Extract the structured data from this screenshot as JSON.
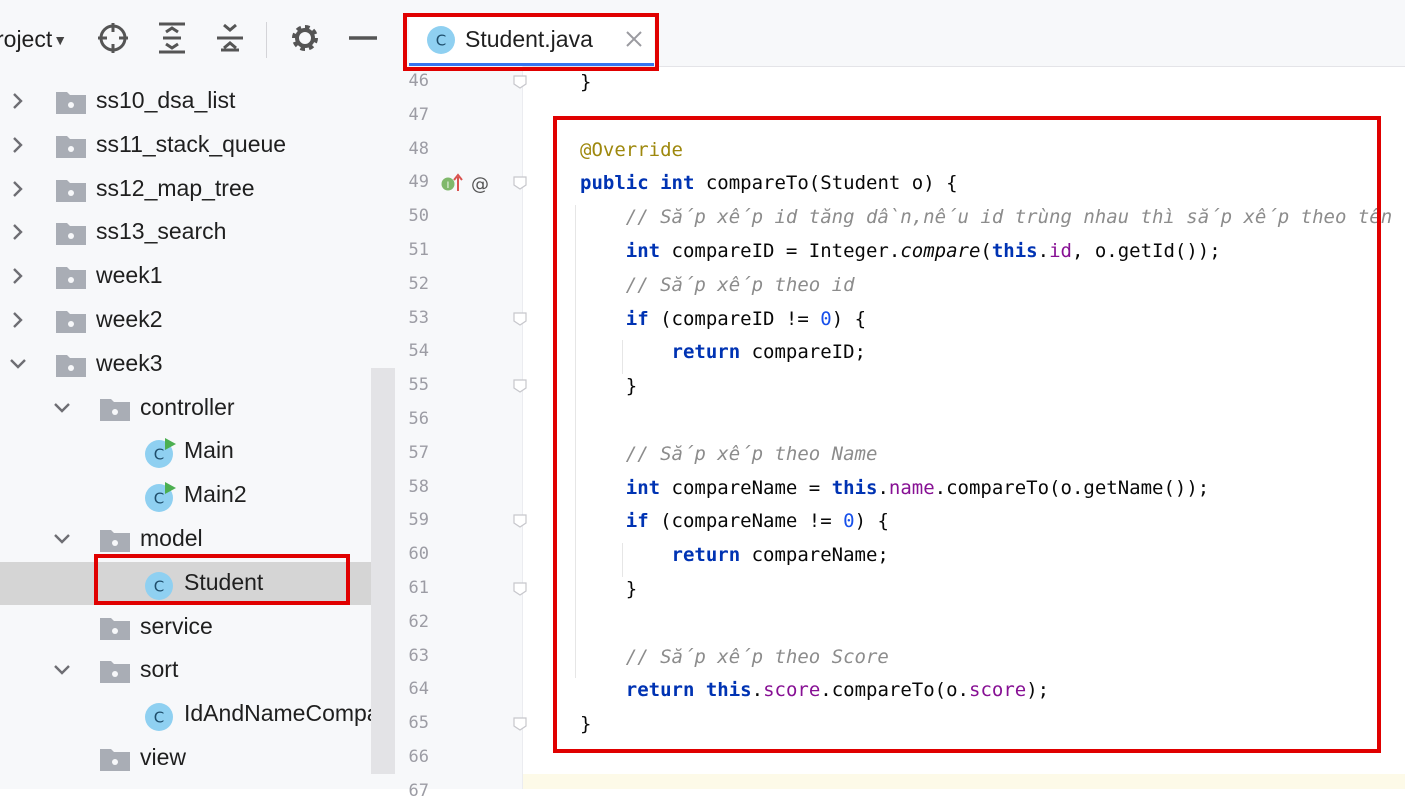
{
  "project_panel": {
    "title": "roject",
    "tree": [
      {
        "label": "ss10_dsa_list",
        "type": "folder",
        "indent": 0,
        "expanded": false
      },
      {
        "label": "ss11_stack_queue",
        "type": "folder",
        "indent": 0,
        "expanded": false
      },
      {
        "label": "ss12_map_tree",
        "type": "folder",
        "indent": 0,
        "expanded": false
      },
      {
        "label": "ss13_search",
        "type": "folder",
        "indent": 0,
        "expanded": false
      },
      {
        "label": "week1",
        "type": "folder",
        "indent": 0,
        "expanded": false
      },
      {
        "label": "week2",
        "type": "folder",
        "indent": 0,
        "expanded": false
      },
      {
        "label": "week3",
        "type": "folder",
        "indent": 0,
        "expanded": true
      },
      {
        "label": "controller",
        "type": "folder",
        "indent": 1,
        "expanded": true
      },
      {
        "label": "Main",
        "type": "main-class",
        "indent": 2
      },
      {
        "label": "Main2",
        "type": "main-class",
        "indent": 2
      },
      {
        "label": "model",
        "type": "folder",
        "indent": 1,
        "expanded": true
      },
      {
        "label": "Student",
        "type": "class",
        "indent": 2,
        "selected": true
      },
      {
        "label": "service",
        "type": "folder",
        "indent": 1,
        "leaf": true
      },
      {
        "label": "sort",
        "type": "folder",
        "indent": 1,
        "expanded": true
      },
      {
        "label": "IdAndNameComparator",
        "type": "class",
        "indent": 2
      },
      {
        "label": "view",
        "type": "folder",
        "indent": 1,
        "leaf": true
      }
    ]
  },
  "editor": {
    "tab": {
      "label": "Student.java",
      "icon": "class-icon"
    },
    "first_line_number": 46,
    "code_lines": [
      [
        {
          "t": "}"
        }
      ],
      [],
      [
        {
          "t": "@Override",
          "c": "ann"
        }
      ],
      [
        {
          "t": "public",
          "c": "kw"
        },
        {
          "t": " "
        },
        {
          "t": "int",
          "c": "kw"
        },
        {
          "t": " compareTo(Student o) {"
        }
      ],
      [
        {
          "t": "    "
        },
        {
          "t": "// Sắp xếp id tăng dần,nếu id trùng nhau thì sắp xếp theo tên",
          "c": "cm"
        }
      ],
      [
        {
          "t": "    "
        },
        {
          "t": "int",
          "c": "kw"
        },
        {
          "t": " compareID = Integer."
        },
        {
          "t": "compare",
          "c": "it"
        },
        {
          "t": "("
        },
        {
          "t": "this",
          "c": "kw"
        },
        {
          "t": "."
        },
        {
          "t": "id",
          "c": "fld"
        },
        {
          "t": ", o.getId());"
        }
      ],
      [
        {
          "t": "    "
        },
        {
          "t": "// Sắp xếp theo id",
          "c": "cm"
        }
      ],
      [
        {
          "t": "    "
        },
        {
          "t": "if",
          "c": "kw"
        },
        {
          "t": " (compareID != "
        },
        {
          "t": "0",
          "c": "num"
        },
        {
          "t": ") {"
        }
      ],
      [
        {
          "t": "        "
        },
        {
          "t": "return",
          "c": "kw"
        },
        {
          "t": " compareID;"
        }
      ],
      [
        {
          "t": "    }"
        }
      ],
      [],
      [
        {
          "t": "    "
        },
        {
          "t": "// Sắp xếp theo Name",
          "c": "cm"
        }
      ],
      [
        {
          "t": "    "
        },
        {
          "t": "int",
          "c": "kw"
        },
        {
          "t": " compareName = "
        },
        {
          "t": "this",
          "c": "kw"
        },
        {
          "t": "."
        },
        {
          "t": "name",
          "c": "fld"
        },
        {
          "t": ".compareTo(o.getName());"
        }
      ],
      [
        {
          "t": "    "
        },
        {
          "t": "if",
          "c": "kw"
        },
        {
          "t": " (compareName != "
        },
        {
          "t": "0",
          "c": "num"
        },
        {
          "t": ") {"
        }
      ],
      [
        {
          "t": "        "
        },
        {
          "t": "return",
          "c": "kw"
        },
        {
          "t": " compareName;"
        }
      ],
      [
        {
          "t": "    }"
        }
      ],
      [],
      [
        {
          "t": "    "
        },
        {
          "t": "// Sắp xếp theo Score",
          "c": "cm"
        }
      ],
      [
        {
          "t": "    "
        },
        {
          "t": "return",
          "c": "kw"
        },
        {
          "t": " "
        },
        {
          "t": "this",
          "c": "kw"
        },
        {
          "t": "."
        },
        {
          "t": "score",
          "c": "fld"
        },
        {
          "t": ".compareTo(o."
        },
        {
          "t": "score",
          "c": "fld"
        },
        {
          "t": ");"
        }
      ],
      [
        {
          "t": "}"
        }
      ],
      [],
      []
    ]
  },
  "colors": {
    "highlight": "#e00000",
    "tab_accent": "#3574f0",
    "keyword": "#0033b3",
    "annotation": "#9e880d",
    "comment": "#8c8c8c",
    "number": "#1750eb",
    "field": "#871094"
  }
}
